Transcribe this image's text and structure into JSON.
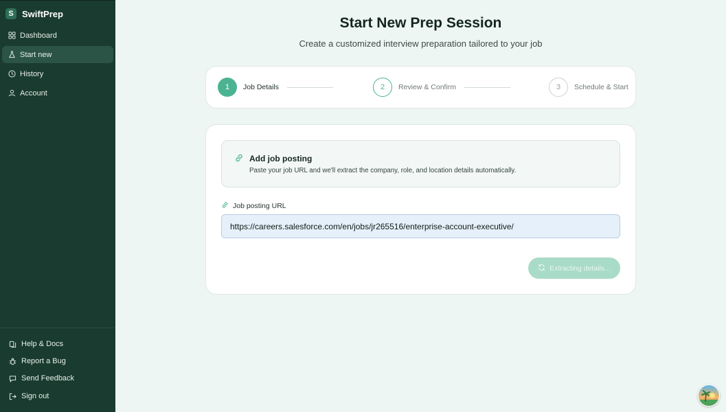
{
  "app": {
    "name": "SwiftPrep",
    "logo_letter": "S",
    "accent_color": "#4cb392",
    "sidebar_color": "#1a3b2f"
  },
  "sidebar": {
    "items": [
      {
        "label": "Dashboard",
        "icon": "grid-icon"
      },
      {
        "label": "Start new",
        "icon": "flask-icon",
        "active": true
      },
      {
        "label": "History",
        "icon": "clock-icon"
      },
      {
        "label": "Account",
        "icon": "user-icon"
      }
    ],
    "bottom_items": [
      {
        "label": "Help & Docs",
        "icon": "book-icon"
      },
      {
        "label": "Report a Bug",
        "icon": "bug-icon"
      },
      {
        "label": "Send Feedback",
        "icon": "message-icon"
      },
      {
        "label": "Sign out",
        "icon": "sign-out-icon"
      }
    ]
  },
  "header": {
    "title": "Start New Prep Session",
    "subtitle": "Create a customized interview preparation tailored to your job"
  },
  "stepper": {
    "steps": [
      {
        "number": "1",
        "label": "Job Details",
        "state": "active"
      },
      {
        "number": "2",
        "label": "Review & Confirm",
        "state": "next"
      },
      {
        "number": "3",
        "label": "Schedule & Start",
        "state": "future"
      }
    ]
  },
  "job_posting": {
    "title": "Add job posting",
    "description": "Paste your job URL and we'll extract the company, role, and location details automatically.",
    "field_label": "Job posting URL",
    "url_value": "https://careers.salesforce.com/en/jobs/jr265516/enterprise-account-executive/",
    "extract_button_label": "Extracting details...",
    "extract_button_state": "loading"
  }
}
